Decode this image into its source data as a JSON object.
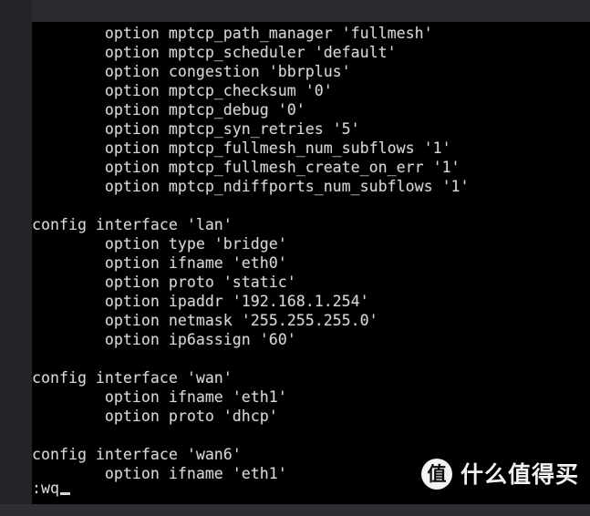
{
  "window": {
    "kind": "terminal",
    "editor": "vi",
    "background_color": "#000000",
    "frame_color": "#26262a",
    "text_color": "#d6d6d6"
  },
  "terminal": {
    "lines": [
      "        option mptcp_path_manager 'fullmesh'",
      "        option mptcp_scheduler 'default'",
      "        option congestion 'bbrplus'",
      "        option mptcp_checksum '0'",
      "        option mptcp_debug '0'",
      "        option mptcp_syn_retries '5'",
      "        option mptcp_fullmesh_num_subflows '1'",
      "        option mptcp_fullmesh_create_on_err '1'",
      "        option mptcp_ndiffports_num_subflows '1'",
      "",
      "config interface 'lan'",
      "        option type 'bridge'",
      "        option ifname 'eth0'",
      "        option proto 'static'",
      "        option ipaddr '192.168.1.254'",
      "        option netmask '255.255.255.0'",
      "        option ip6assign '60'",
      "",
      "config interface 'wan'",
      "        option ifname 'eth1'",
      "        option proto 'dhcp'",
      "",
      "config interface 'wan6'",
      "        option ifname 'eth1'"
    ],
    "command_line": ":wq",
    "cursor": "block"
  },
  "watermark": {
    "logo_char": "值",
    "text": "什么值得买"
  }
}
